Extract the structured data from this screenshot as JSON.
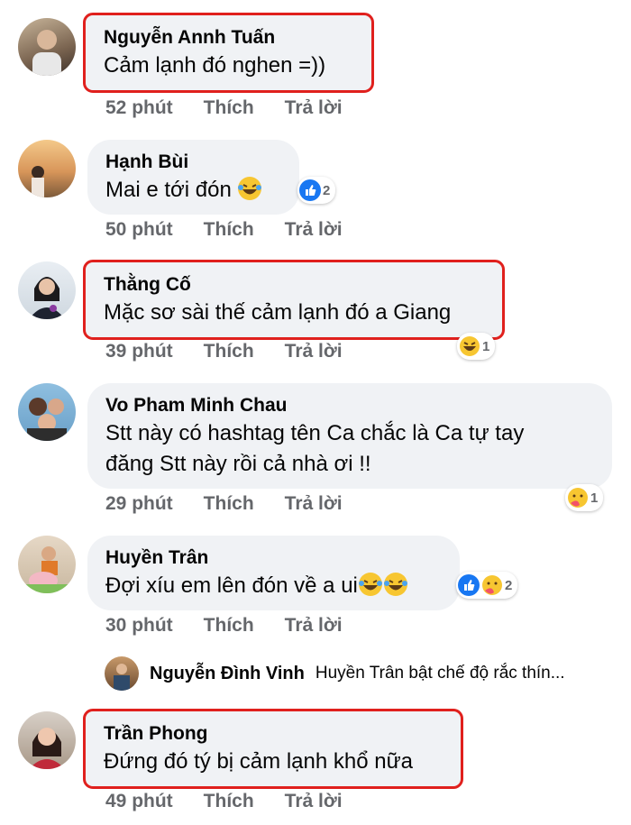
{
  "comments": [
    {
      "name": "Nguyễn Annh Tuấn",
      "text": "Cảm lạnh đó nghen =))",
      "time": "52 phút",
      "like": "Thích",
      "reply": "Trả lời"
    },
    {
      "name": "Hạnh Bùi",
      "text": "Mai e tới đón",
      "time": "50 phút",
      "like": "Thích",
      "reply": "Trả lời",
      "reaction_count": "2"
    },
    {
      "name": "Thằng Cố",
      "text": "Mặc sơ sài thế cảm lạnh đó a Giang",
      "time": "39 phút",
      "like": "Thích",
      "reply": "Trả lời",
      "reaction_count": "1"
    },
    {
      "name": "Vo Pham Minh Chau",
      "text": "Stt này có hashtag tên Ca chắc là Ca tự tay đăng Stt này rồi cả nhà ơi !!",
      "time": "29 phút",
      "like": "Thích",
      "reply": "Trả lời",
      "reaction_count": "1"
    },
    {
      "name": "Huyền Trân",
      "text": "Đợi xíu em lên đón về a ui",
      "time": "30 phút",
      "like": "Thích",
      "reply": "Trả lời",
      "reaction_count": "2"
    },
    {
      "name": "Trần Phong",
      "text": "Đứng đó tý bị cảm lạnh khổ nữa",
      "time": "49 phút",
      "like": "Thích",
      "reply": "Trả lời"
    }
  ],
  "reply_preview": {
    "name": "Nguyễn Đình Vinh",
    "text": "Huyền Trân bật chế độ rắc thín..."
  },
  "colors": {
    "highlight": "#e0201d",
    "bubble": "#f0f2f5",
    "meta": "#65676b",
    "like_blue": "#1877f2"
  }
}
